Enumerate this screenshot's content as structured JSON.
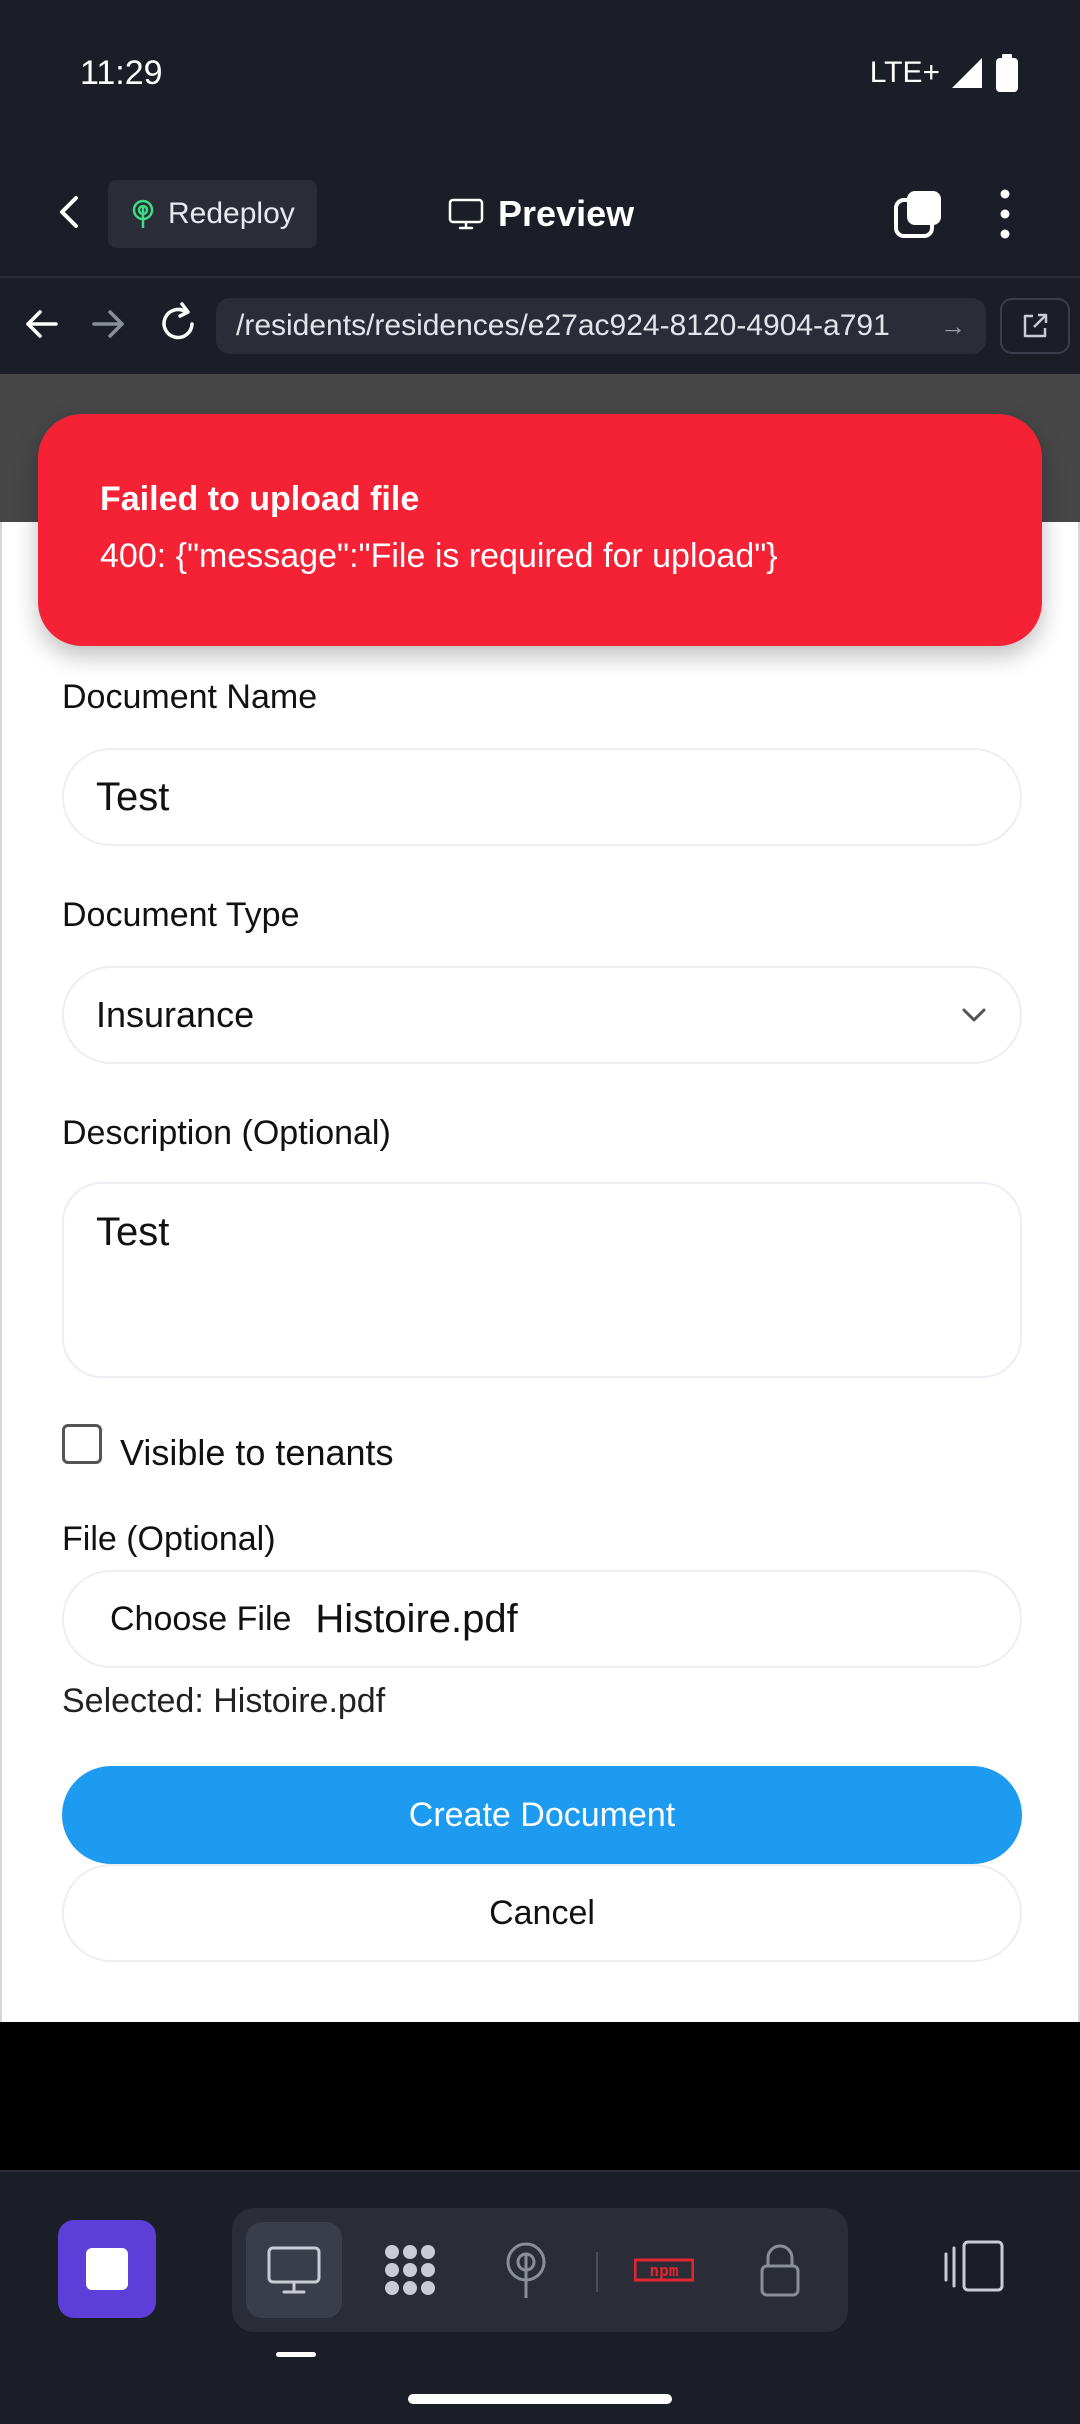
{
  "status_bar": {
    "time": "11:29",
    "network": "LTE+"
  },
  "header": {
    "redeploy_label": "Redeploy",
    "preview_label": "Preview"
  },
  "url_bar": {
    "url": "/residents/residences/e27ac924-8120-4904-a791"
  },
  "toast": {
    "title": "Failed to upload file",
    "message": "400: {\"message\":\"File is required for upload\"}",
    "color": "#f52235"
  },
  "form": {
    "document_name_label": "Document Name",
    "document_name_value": "Test",
    "document_type_label": "Document Type",
    "document_type_value": "Insurance",
    "description_label": "Description (Optional)",
    "description_value": "Test",
    "visible_label": "Visible to tenants",
    "visible_checked": false,
    "file_label": "File (Optional)",
    "choose_file_label": "Choose File",
    "file_name": "Histoire.pdf",
    "selected_text": "Selected: Histoire.pdf",
    "create_label": "Create Document",
    "cancel_label": "Cancel",
    "primary_color": "#1d9bf0"
  },
  "dock": {
    "items": [
      "monitor-icon",
      "dots-grid-icon",
      "antenna-icon",
      "npm-icon",
      "lock-icon"
    ],
    "npm_label": "npm"
  }
}
